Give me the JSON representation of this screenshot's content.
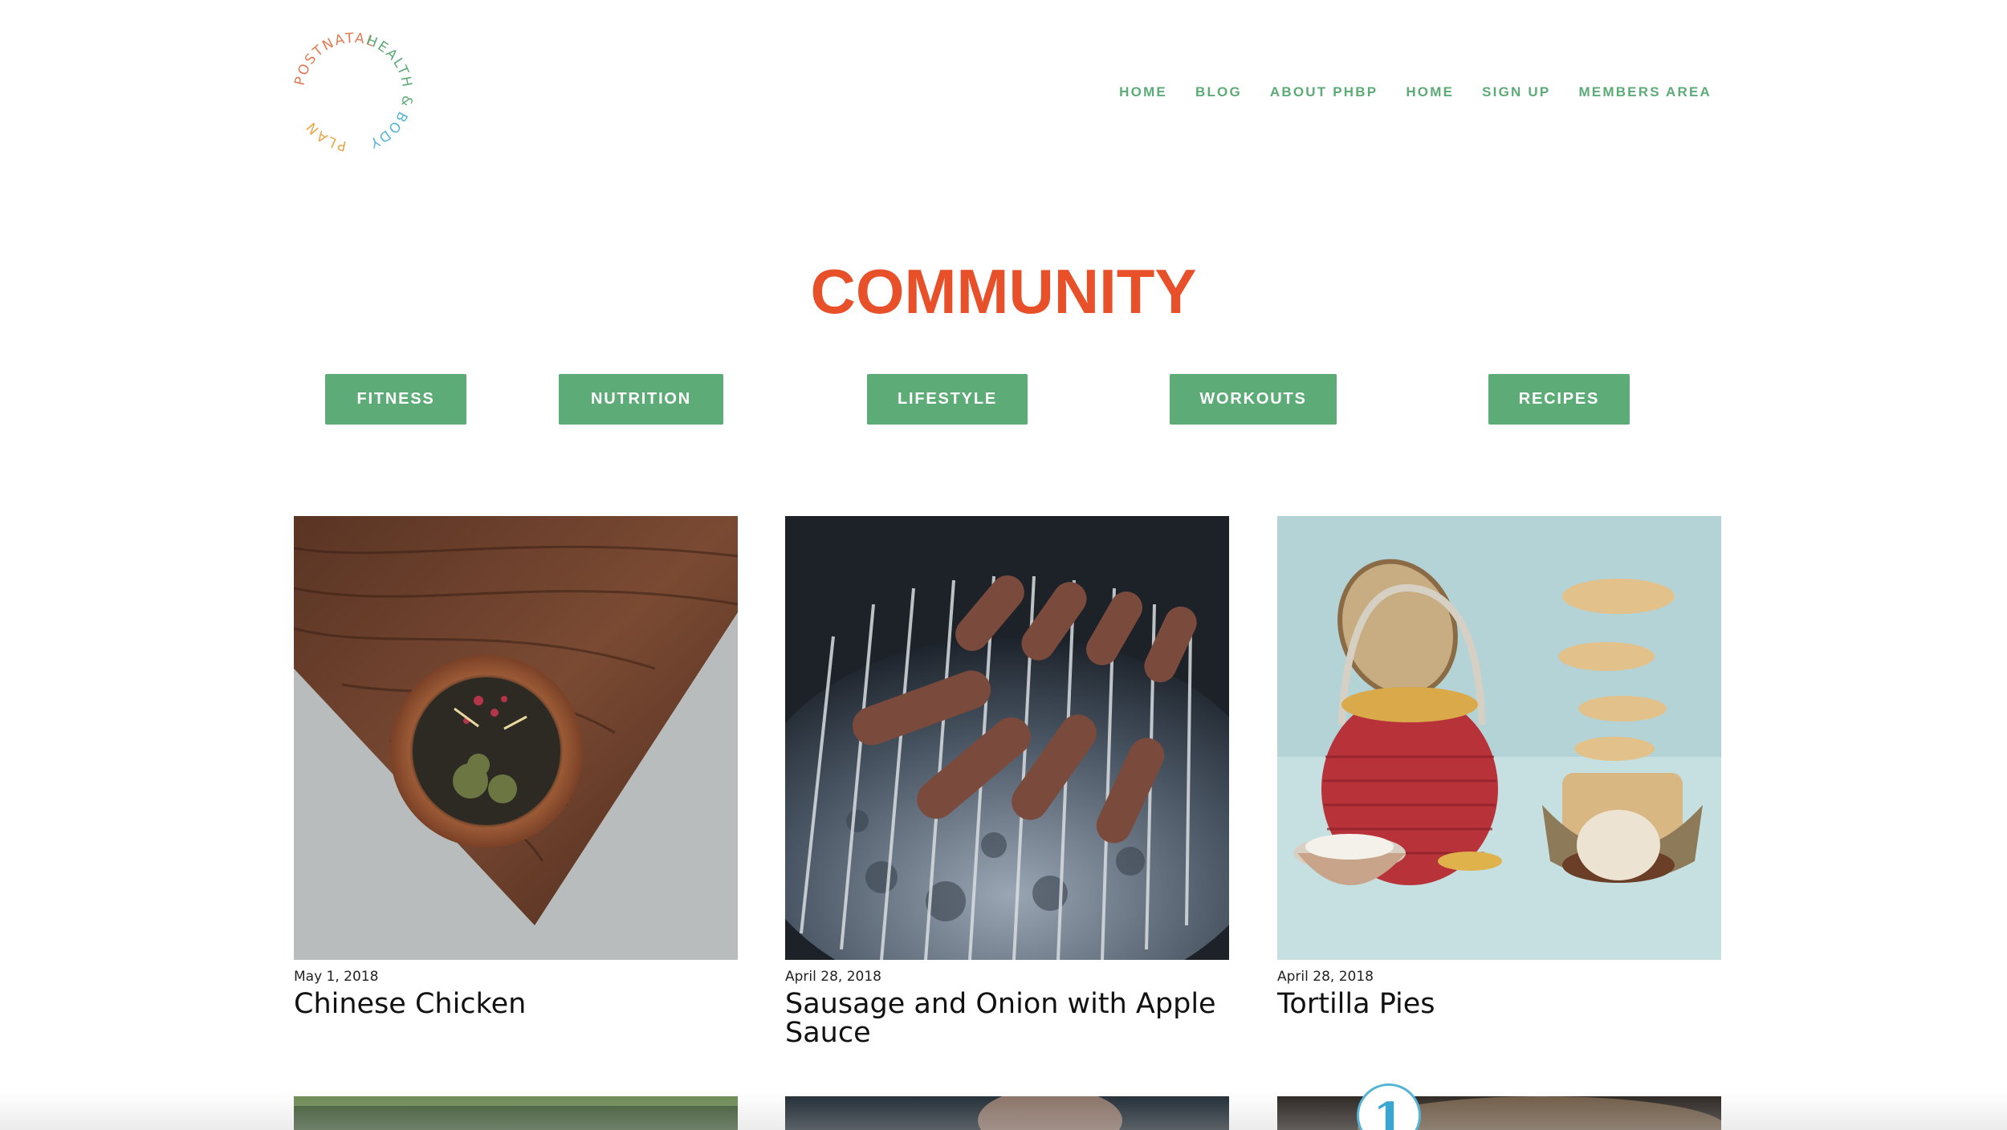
{
  "logo": {
    "arc_top": "POSTNATAL",
    "arc_right": "HEALTH &",
    "arc_bottom": "BODY",
    "arc_left": "PLAN",
    "colors": {
      "postnatal": "#e07a55",
      "health": "#5dab77",
      "body": "#56b4d6",
      "plan": "#e8a84a"
    }
  },
  "nav": {
    "items": [
      "HOME",
      "BLOG",
      "ABOUT PHBP",
      "HOME",
      "SIGN UP",
      "MEMBERS AREA"
    ]
  },
  "page_title": "COMMUNITY",
  "categories": [
    "FITNESS",
    "NUTRITION",
    "LIFESTYLE",
    "WORKOUTS",
    "RECIPES"
  ],
  "posts": [
    {
      "date": "May 1, 2018",
      "title": "Chinese Chicken"
    },
    {
      "date": "April 28, 2018",
      "title": "Sausage and Onion with Apple Sauce"
    },
    {
      "date": "April 28, 2018",
      "title": "Tortilla Pies"
    }
  ],
  "badge": {
    "text": "1"
  },
  "colors": {
    "accent_green": "#5dab77",
    "title_orange": "#e8502a",
    "badge_blue": "#3aa5cf"
  }
}
